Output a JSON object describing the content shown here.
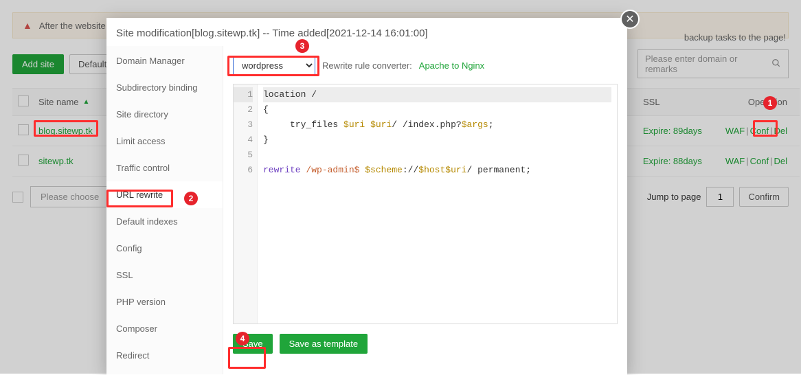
{
  "alert": {
    "text_left": "After the website is",
    "text_right": "backup tasks to the page!"
  },
  "toolbar": {
    "add_site": "Add site",
    "default_p": "Default Pa",
    "search_placeholder": "Please enter domain or remarks"
  },
  "table": {
    "headers": {
      "site": "Site name",
      "ssl": "SSL",
      "op": "Operation"
    },
    "rows": [
      {
        "site": "blog.sitewp.tk",
        "ssl": "Expire: 89days",
        "ops": [
          "WAF",
          "Conf",
          "Del"
        ]
      },
      {
        "site": "sitewp.tk",
        "ssl": "Expire: 88days",
        "ops": [
          "WAF",
          "Conf",
          "Del"
        ]
      }
    ]
  },
  "pager": {
    "choose_placeholder": "Please choose",
    "jump_label": "Jump to page",
    "page": "1",
    "confirm": "Confirm"
  },
  "modal": {
    "title": "Site modification[blog.sitewp.tk] -- Time added[2021-12-14 16:01:00]",
    "nav": [
      "Domain Manager",
      "Subdirectory binding",
      "Site directory",
      "Limit access",
      "Traffic control",
      "URL rewrite",
      "Default indexes",
      "Config",
      "SSL",
      "PHP version",
      "Composer",
      "Redirect"
    ],
    "active_nav_index": 5,
    "select_value": "wordpress",
    "conv_label": "Rewrite rule converter:",
    "conv_link": "Apache to Nginx",
    "code_lines": {
      "l1": "location /",
      "l2": "{",
      "l3a": "     try_files ",
      "l3b": "$uri",
      "l3c": " ",
      "l3d": "$uri",
      "l3e": "/ /index.php?",
      "l3f": "$args",
      "l3g": ";",
      "l4": "}",
      "l5": "",
      "l6a": "rewrite",
      "l6b": " ",
      "l6c": "/wp-admin$",
      "l6d": " ",
      "l6e": "$scheme",
      "l6f": "://",
      "l6g": "$host$uri",
      "l6h": "/ permanent;"
    },
    "save": "Save",
    "save_template": "Save as template"
  },
  "annotations": {
    "b1": "1",
    "b2": "2",
    "b3": "3",
    "b4": "4"
  }
}
